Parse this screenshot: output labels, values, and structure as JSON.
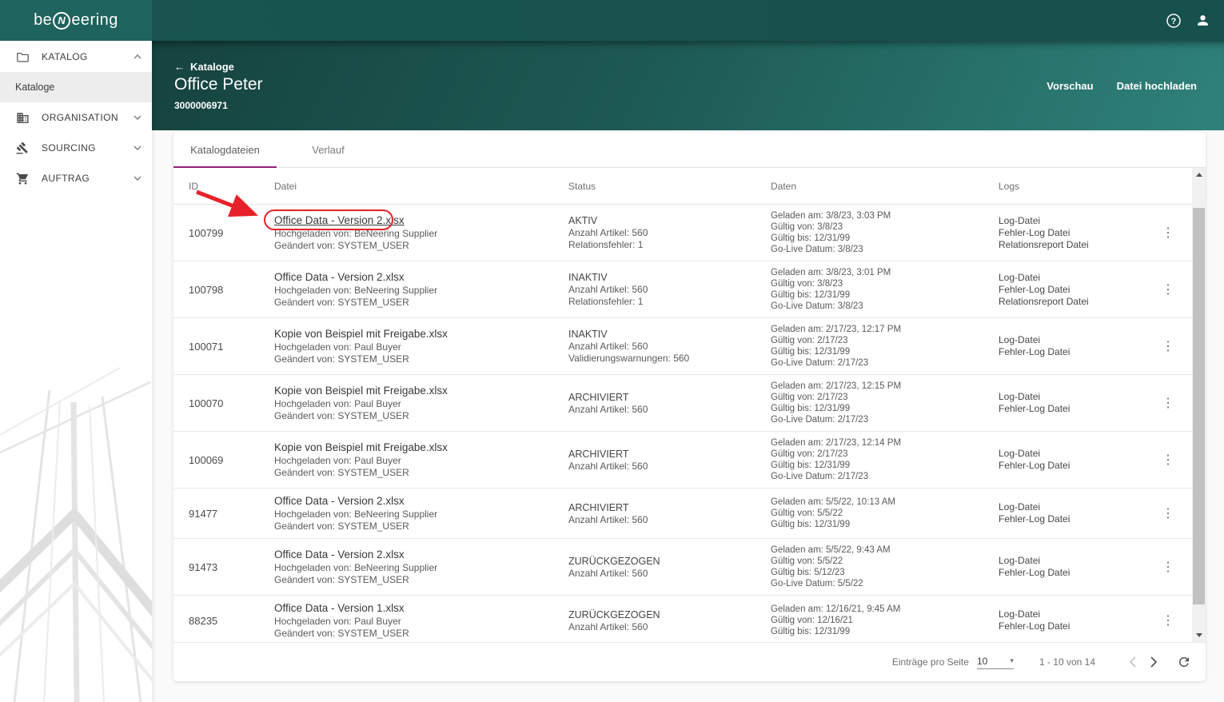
{
  "colors": {
    "topbar": "#17514d",
    "logo_block": "#1e635d",
    "header_gradient_start": "#16433f",
    "header_gradient_end": "#2f827b",
    "tab_underline": "#8e2176",
    "annotation_red": "#e62129"
  },
  "icons": {
    "back": "←",
    "kebab": "⋮",
    "caret_down": "▾"
  },
  "topbar": {
    "logo_pre": "be",
    "logo_mid": "N",
    "logo_post": "eering"
  },
  "sidebar": {
    "items": [
      {
        "label": "KATALOG"
      },
      {
        "label": "Kataloge",
        "active": true
      },
      {
        "label": "ORGANISATION"
      },
      {
        "label": "SOURCING"
      },
      {
        "label": "AUFTRAG"
      }
    ]
  },
  "header": {
    "back_label": "Kataloge",
    "title": "Office Peter",
    "subtitle": "3000006971",
    "preview_button": "Vorschau",
    "upload_button": "Datei hochladen"
  },
  "tabs": {
    "files": "Katalogdateien",
    "history": "Verlauf"
  },
  "table": {
    "headers": {
      "id": "ID",
      "file": "Datei",
      "status": "Status",
      "dates": "Daten",
      "logs": "Logs"
    },
    "rows": [
      {
        "id": "100799",
        "file": "Office Data - Version 2.xlsx",
        "uploaded": "Hochgeladen von: BeNeering Supplier",
        "changed": "Geändert von: SYSTEM_USER",
        "status": "AKTIV",
        "status2": "Anzahl Artikel: 560",
        "status3": "Relationsfehler: 1",
        "d1": "Geladen am: 3/8/23, 3:03 PM",
        "d2": "Gültig von: 3/8/23",
        "d3": "Gültig bis: 12/31/99",
        "d4": "Go-Live Datum: 3/8/23",
        "log1": "Log-Datei",
        "log2": "Fehler-Log Datei",
        "log3": "Relationsreport Datei"
      },
      {
        "id": "100798",
        "file": "Office Data - Version 2.xlsx",
        "uploaded": "Hochgeladen von: BeNeering Supplier",
        "changed": "Geändert von: SYSTEM_USER",
        "status": "INAKTIV",
        "status2": "Anzahl Artikel: 560",
        "status3": "Relationsfehler: 1",
        "d1": "Geladen am: 3/8/23, 3:01 PM",
        "d2": "Gültig von: 3/8/23",
        "d3": "Gültig bis: 12/31/99",
        "d4": "Go-Live Datum: 3/8/23",
        "log1": "Log-Datei",
        "log2": "Fehler-Log Datei",
        "log3": "Relationsreport Datei"
      },
      {
        "id": "100071",
        "file": "Kopie von Beispiel mit Freigabe.xlsx",
        "uploaded": "Hochgeladen von: Paul Buyer",
        "changed": "Geändert von: SYSTEM_USER",
        "status": "INAKTIV",
        "status2": "Anzahl Artikel: 560",
        "status3": "Validierungswarnungen: 560",
        "d1": "Geladen am: 2/17/23, 12:17 PM",
        "d2": "Gültig von: 2/17/23",
        "d3": "Gültig bis: 12/31/99",
        "d4": "Go-Live Datum: 2/17/23",
        "log1": "Log-Datei",
        "log2": "Fehler-Log Datei"
      },
      {
        "id": "100070",
        "file": "Kopie von Beispiel mit Freigabe.xlsx",
        "uploaded": "Hochgeladen von: Paul Buyer",
        "changed": "Geändert von: SYSTEM_USER",
        "status": "ARCHIVIERT",
        "status2": "Anzahl Artikel: 560",
        "d1": "Geladen am: 2/17/23, 12:15 PM",
        "d2": "Gültig von: 2/17/23",
        "d3": "Gültig bis: 12/31/99",
        "d4": "Go-Live Datum: 2/17/23",
        "log1": "Log-Datei",
        "log2": "Fehler-Log Datei"
      },
      {
        "id": "100069",
        "file": "Kopie von Beispiel mit Freigabe.xlsx",
        "uploaded": "Hochgeladen von: Paul Buyer",
        "changed": "Geändert von: SYSTEM_USER",
        "status": "ARCHIVIERT",
        "status2": "Anzahl Artikel: 560",
        "d1": "Geladen am: 2/17/23, 12:14 PM",
        "d2": "Gültig von: 2/17/23",
        "d3": "Gültig bis: 12/31/99",
        "d4": "Go-Live Datum: 2/17/23",
        "log1": "Log-Datei",
        "log2": "Fehler-Log Datei"
      },
      {
        "id": "91477",
        "file": "Office Data - Version 2.xlsx",
        "uploaded": "Hochgeladen von: BeNeering Supplier",
        "changed": "Geändert von: SYSTEM_USER",
        "status": "ARCHIVIERT",
        "status2": "Anzahl Artikel: 560",
        "d1": "Geladen am: 5/5/22, 10:13 AM",
        "d2": "Gültig von: 5/5/22",
        "d3": "Gültig bis: 12/31/99",
        "log1": "Log-Datei",
        "log2": "Fehler-Log Datei"
      },
      {
        "id": "91473",
        "file": "Office Data - Version 2.xlsx",
        "uploaded": "Hochgeladen von: BeNeering Supplier",
        "changed": "Geändert von: SYSTEM_USER",
        "status": "ZURÜCKGEZOGEN",
        "status2": "Anzahl Artikel: 560",
        "d1": "Geladen am: 5/5/22, 9:43 AM",
        "d2": "Gültig von: 5/5/22",
        "d3": "Gültig bis: 5/12/23",
        "d4": "Go-Live Datum: 5/5/22",
        "log1": "Log-Datei",
        "log2": "Fehler-Log Datei"
      },
      {
        "id": "88235",
        "file": "Office Data - Version 1.xlsx",
        "uploaded": "Hochgeladen von: Paul Buyer",
        "changed": "Geändert von: SYSTEM_USER",
        "status": "ZURÜCKGEZOGEN",
        "status2": "Anzahl Artikel: 560",
        "d1": "Geladen am: 12/16/21, 9:45 AM",
        "d2": "Gültig von: 12/16/21",
        "d3": "Gültig bis: 12/31/99",
        "log1": "Log-Datei",
        "log2": "Fehler-Log Datei"
      }
    ]
  },
  "pagination": {
    "per_page_label": "Einträge pro Seite",
    "per_page": "10",
    "range": "1 - 10 von 14"
  },
  "annotation": {
    "type": "arrow-and-ellipse",
    "target_row_id": "100799",
    "color": "#e62129"
  }
}
